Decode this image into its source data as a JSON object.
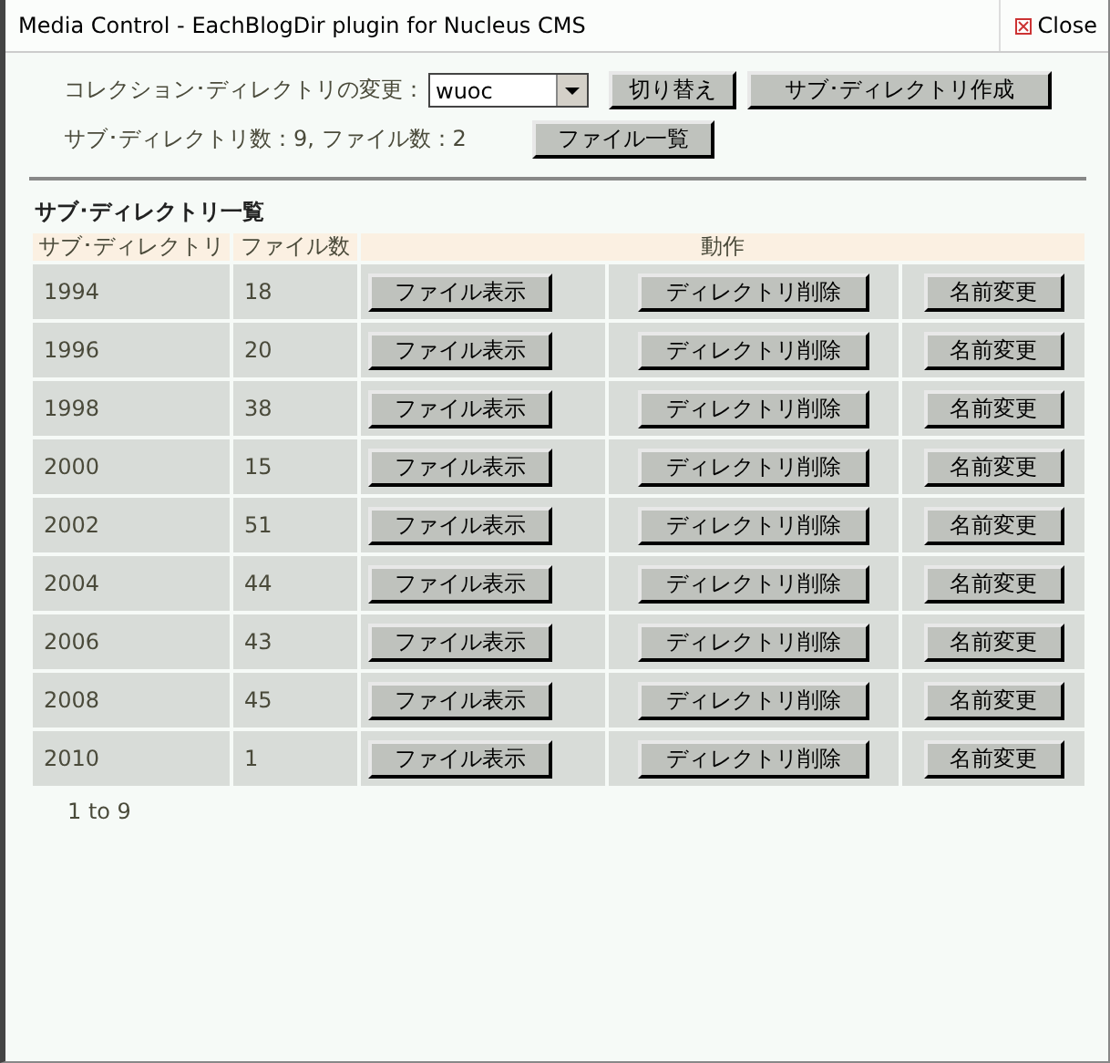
{
  "window": {
    "title": "Media Control - EachBlogDir plugin for Nucleus CMS",
    "close_label": "Close"
  },
  "controls": {
    "collection_label": "コレクション･ディレクトリの変更：",
    "collection_value": "wuoc",
    "switch_button": "切り替え",
    "create_button": "サブ･ディレクトリ作成",
    "counts": "サブ･ディレクトリ数：9, ファイル数：2",
    "file_list_button": "ファイル一覧"
  },
  "section_title": "サブ･ディレクトリ一覧",
  "table": {
    "columns": [
      "サブ･ディレクトリ",
      "ファイル数",
      "動作"
    ],
    "rows": [
      {
        "dir": "1994",
        "files": "18",
        "actions": [
          "ファイル表示",
          "ディレクトリ削除",
          "名前変更"
        ]
      },
      {
        "dir": "1996",
        "files": "20",
        "actions": [
          "ファイル表示",
          "ディレクトリ削除",
          "名前変更"
        ]
      },
      {
        "dir": "1998",
        "files": "38",
        "actions": [
          "ファイル表示",
          "ディレクトリ削除",
          "名前変更"
        ]
      },
      {
        "dir": "2000",
        "files": "15",
        "actions": [
          "ファイル表示",
          "ディレクトリ削除",
          "名前変更"
        ]
      },
      {
        "dir": "2002",
        "files": "51",
        "actions": [
          "ファイル表示",
          "ディレクトリ削除",
          "名前変更"
        ]
      },
      {
        "dir": "2004",
        "files": "44",
        "actions": [
          "ファイル表示",
          "ディレクトリ削除",
          "名前変更"
        ]
      },
      {
        "dir": "2006",
        "files": "43",
        "actions": [
          "ファイル表示",
          "ディレクトリ削除",
          "名前変更"
        ]
      },
      {
        "dir": "2008",
        "files": "45",
        "actions": [
          "ファイル表示",
          "ディレクトリ削除",
          "名前変更"
        ]
      },
      {
        "dir": "2010",
        "files": "1",
        "actions": [
          "ファイル表示",
          "ディレクトリ削除",
          "名前変更"
        ]
      }
    ]
  },
  "pagination": "1 to 9"
}
